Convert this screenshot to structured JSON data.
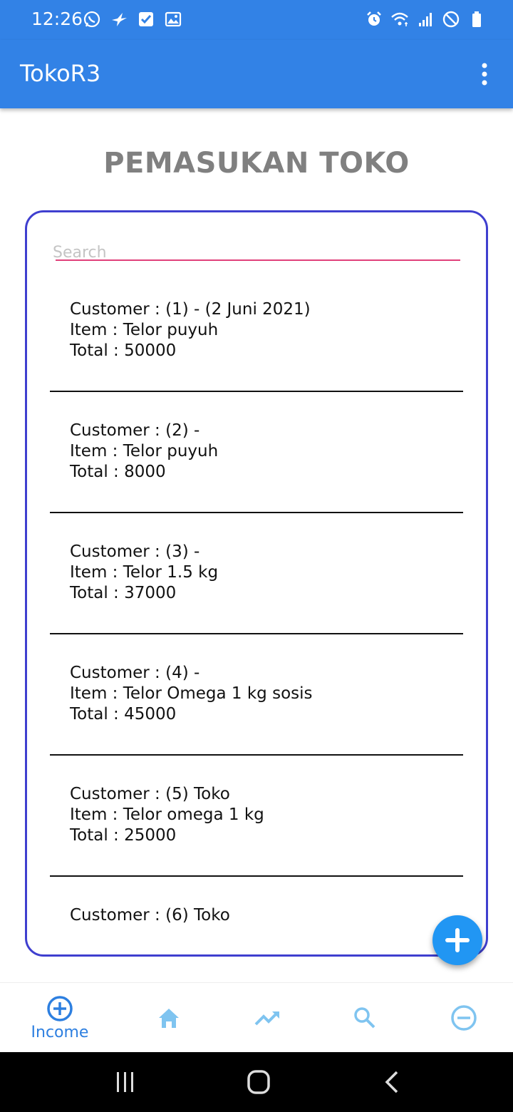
{
  "status_bar": {
    "time": "12:26",
    "left_icons": [
      "whatsapp-icon",
      "bird-icon",
      "checkbox-icon",
      "image-icon"
    ],
    "right_icons": [
      "alarm-icon",
      "wifi-icon",
      "signal-icon",
      "dnd-icon",
      "battery-icon"
    ]
  },
  "app_bar": {
    "title": "TokoR3",
    "menu_icon": "overflow-menu-icon"
  },
  "page": {
    "title": "PEMASUKAN TOKO"
  },
  "search": {
    "placeholder": "Search",
    "value": ""
  },
  "entries": [
    {
      "customer": "Customer : (1) - (2 Juni 2021)",
      "item": "Item : Telor puyuh",
      "total": "Total : 50000"
    },
    {
      "customer": "Customer : (2) -",
      "item": "Item : Telor puyuh",
      "total": "Total : 8000"
    },
    {
      "customer": "Customer : (3) -",
      "item": "Item : Telor 1.5 kg",
      "total": "Total : 37000"
    },
    {
      "customer": "Customer : (4) -",
      "item": "Item : Telor Omega 1 kg sosis",
      "total": "Total : 45000"
    },
    {
      "customer": "Customer : (5) Toko",
      "item": "Item : Telor omega 1 kg",
      "total": "Total : 25000"
    },
    {
      "customer": "Customer : (6) Toko",
      "item": "",
      "total": ""
    }
  ],
  "fab": {
    "icon": "add-icon"
  },
  "bottom_nav": {
    "items": [
      {
        "icon": "add-circle-icon",
        "label": "Income",
        "active": true
      },
      {
        "icon": "home-icon",
        "label": ""
      },
      {
        "icon": "trending-up-icon",
        "label": ""
      },
      {
        "icon": "search-icon",
        "label": ""
      },
      {
        "icon": "remove-circle-icon",
        "label": ""
      }
    ]
  },
  "colors": {
    "primary": "#3282e6",
    "card_border": "#3f3fcf",
    "fab": "#2196f3",
    "nav_active": "#2d7fe0",
    "nav_inactive": "#7fc4f0",
    "search_underline": "#e0407a",
    "title_gray": "#808080"
  }
}
